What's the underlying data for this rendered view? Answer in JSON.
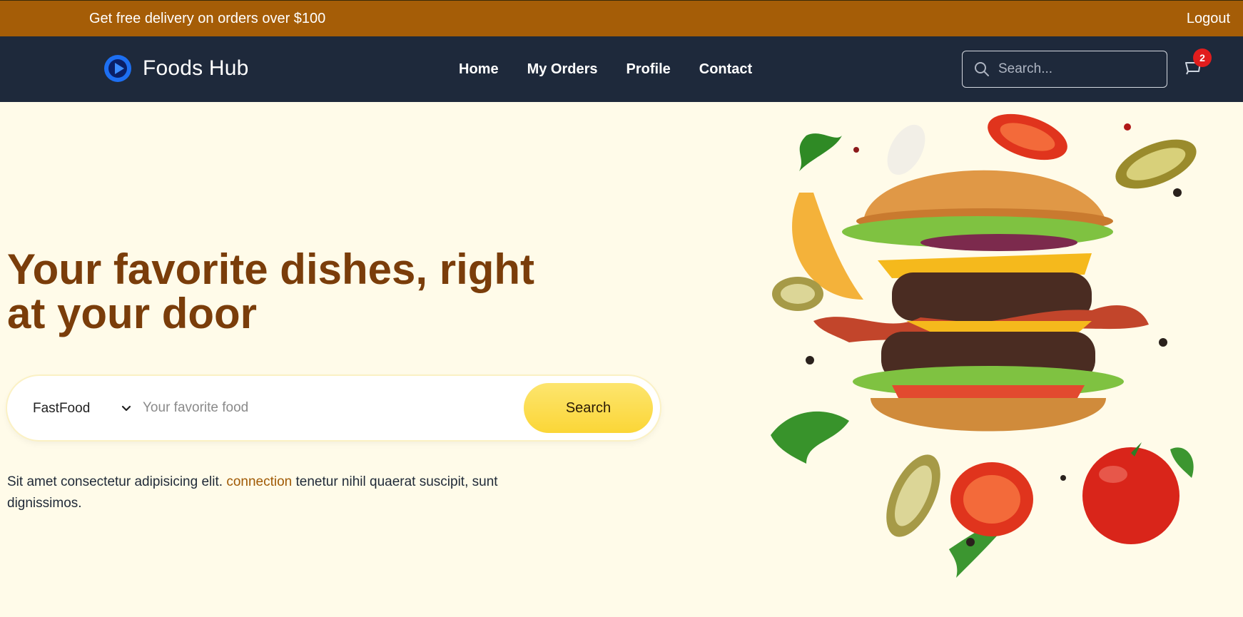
{
  "topbar": {
    "promo_text": "Get free delivery on orders over $100",
    "logout_label": "Logout"
  },
  "navbar": {
    "brand_name": "Foods Hub",
    "links": [
      {
        "label": "Home"
      },
      {
        "label": "My Orders"
      },
      {
        "label": "Profile"
      },
      {
        "label": "Contact"
      }
    ],
    "search_placeholder": "Search...",
    "cart_count": "2",
    "icons": {
      "logo": "play-logo-icon",
      "search": "search-icon",
      "cart": "cart-icon"
    }
  },
  "hero": {
    "title": "Your favorite dishes, right at your door",
    "category_selected": "FastFood",
    "food_placeholder": "Your favorite food",
    "search_button": "Search",
    "text_before": "Sit amet consectetur adipisicing elit. ",
    "text_link": "connection",
    "text_after": " tenetur nihil quaerat suscipit, sunt dignissimos."
  },
  "colors": {
    "topbar_bg": "#a55d07",
    "navbar_bg": "#1e293b",
    "page_bg": "#fffbe9",
    "title": "#7a3d0a",
    "button": "#fbd637",
    "badge": "#e11d1d"
  }
}
